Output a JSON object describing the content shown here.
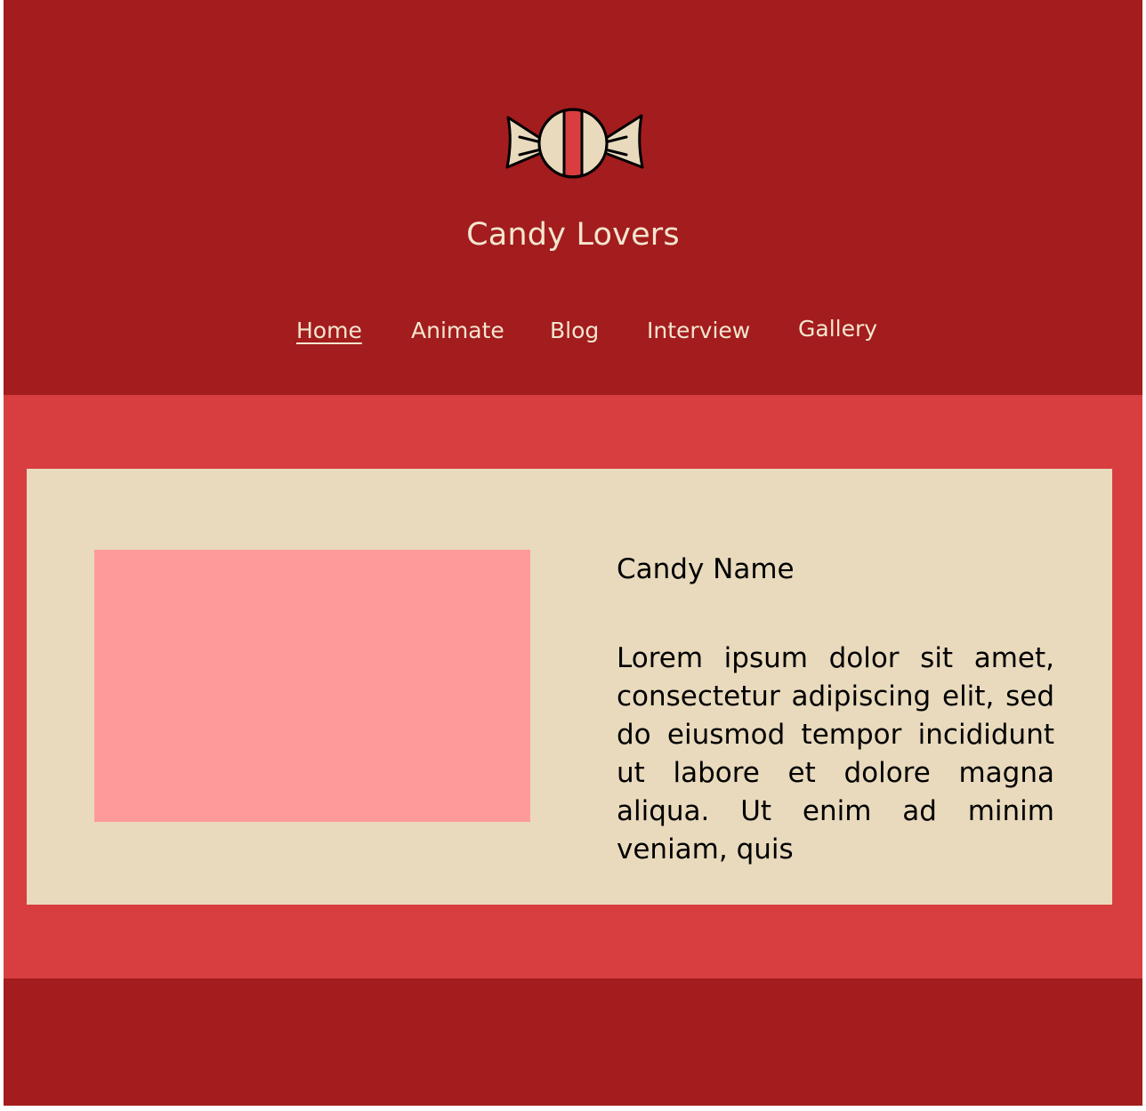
{
  "site": {
    "title": "Candy Lovers",
    "logo_icon": "wrapped-candy-icon"
  },
  "nav": {
    "items": [
      {
        "label": "Home",
        "active": true
      },
      {
        "label": "Animate",
        "active": false
      },
      {
        "label": "Blog",
        "active": false
      },
      {
        "label": "Interview",
        "active": false
      },
      {
        "label": "Gallery",
        "active": false
      }
    ]
  },
  "card": {
    "name": "Candy Name",
    "description": "Lorem ipsum dolor sit amet, consectetur adipiscing elit, sed do eiusmod tempor incididunt ut labore et dolore magna aliqua. Ut enim ad minim veniam, quis"
  },
  "colors": {
    "header_bg": "#a31c1e",
    "main_bg": "#d83e40",
    "card_bg": "#e9dabd",
    "image_placeholder": "#fe9a9a",
    "header_text": "#f4e6cf",
    "candy_stripe": "#d83e40"
  }
}
